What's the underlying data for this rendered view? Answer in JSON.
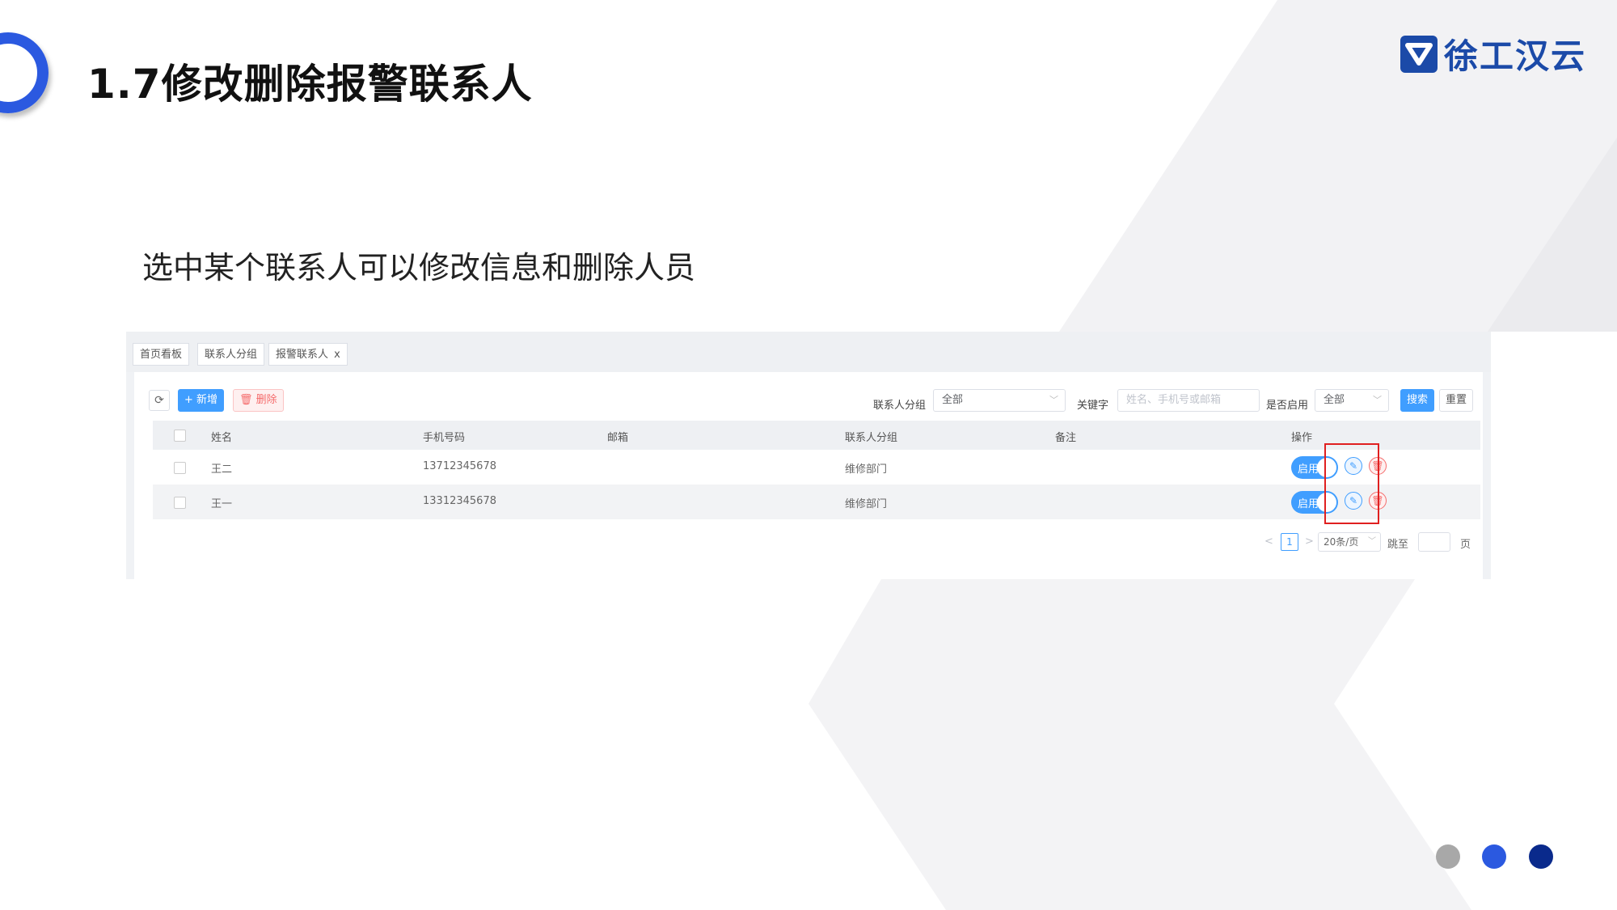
{
  "slide": {
    "title": "1.7修改删除报警联系人",
    "subtitle": "选中某个联系人可以修改信息和删除人员",
    "logo_text": "徐工汉云"
  },
  "tabs": [
    {
      "label": "首页看板"
    },
    {
      "label": "联系人分组"
    },
    {
      "label": "报警联系人",
      "close": "x"
    }
  ],
  "toolbar": {
    "refresh_icon": "refresh-icon",
    "add_label": "+ 新增",
    "delete_label": "删除"
  },
  "filters": {
    "group_label": "联系人分组",
    "group_value": "全部",
    "keyword_label": "关键字",
    "keyword_placeholder": "姓名、手机号或邮箱",
    "enabled_label": "是否启用",
    "enabled_value": "全部",
    "search_label": "搜索",
    "reset_label": "重置"
  },
  "table": {
    "headers": [
      "姓名",
      "手机号码",
      "邮箱",
      "联系人分组",
      "备注",
      "操作"
    ],
    "rows": [
      {
        "name": "王二",
        "phone": "13712345678",
        "email": "",
        "group": "维修部门",
        "remark": "",
        "switch_label": "启用"
      },
      {
        "name": "王一",
        "phone": "13312345678",
        "email": "",
        "group": "维修部门",
        "remark": "",
        "switch_label": "启用"
      }
    ]
  },
  "pagination": {
    "prev": "<",
    "current_page": "1",
    "next": ">",
    "page_size": "20条/页",
    "jump_label": "跳至",
    "page_unit": "页"
  },
  "colors": {
    "brand": "#1b4aa8",
    "accent": "#2b59e0",
    "primary": "#409eff",
    "danger": "#f56c6c",
    "highlight": "#e02020",
    "dot_gray": "#a8a8a8",
    "dot_blue": "#2b59e0",
    "dot_navy": "#0a2a8c"
  }
}
